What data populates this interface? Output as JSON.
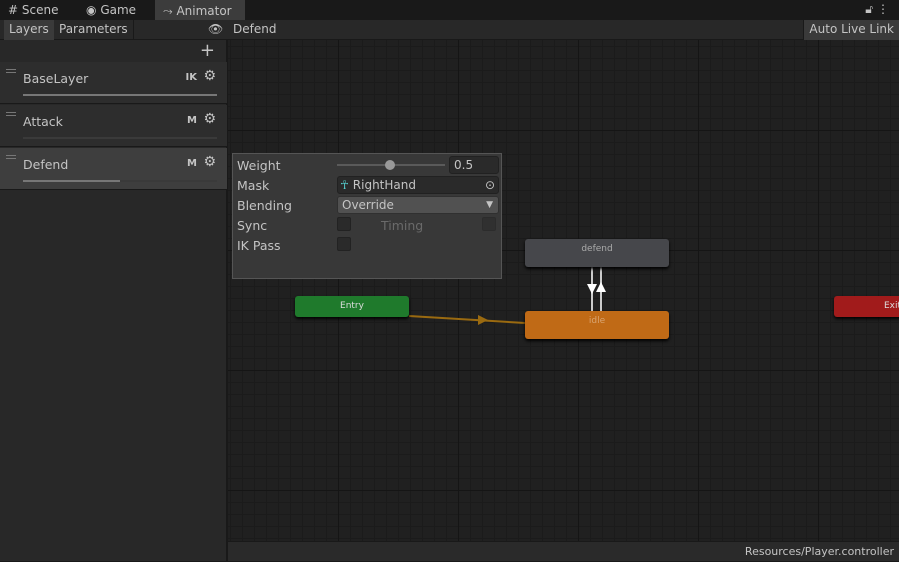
{
  "tabs": [
    {
      "label": "Scene",
      "icon": "grid-icon"
    },
    {
      "label": "Game",
      "icon": "gamepad-icon"
    },
    {
      "label": "Animator",
      "icon": "animator-icon",
      "active": true
    }
  ],
  "toolbar": {
    "layers": "Layers",
    "parameters": "Parameters",
    "breadcrumb": "Defend",
    "auto_live_link": "Auto Live Link"
  },
  "layers": [
    {
      "name": "BaseLayer",
      "tag": "IK",
      "weight": 1
    },
    {
      "name": "Attack",
      "tag": "M",
      "weight": 0
    },
    {
      "name": "Defend",
      "tag": "M",
      "weight": 0.5,
      "selected": true
    }
  ],
  "settings": {
    "weight_label": "Weight",
    "weight_value": "0.5",
    "mask_label": "Mask",
    "mask_value": "RightHand",
    "blending_label": "Blending",
    "blending_value": "Override",
    "sync_label": "Sync",
    "timing_label": "Timing",
    "ik_pass_label": "IK Pass"
  },
  "nodes": {
    "entry": "Entry",
    "defend": "defend",
    "idle": "idle",
    "exit": "Exit"
  },
  "colors": {
    "entry": "#1f7a2c",
    "idle": "#c06a16",
    "exit": "#a11b1b",
    "state": "#46474b"
  },
  "status": "Resources/Player.controller"
}
